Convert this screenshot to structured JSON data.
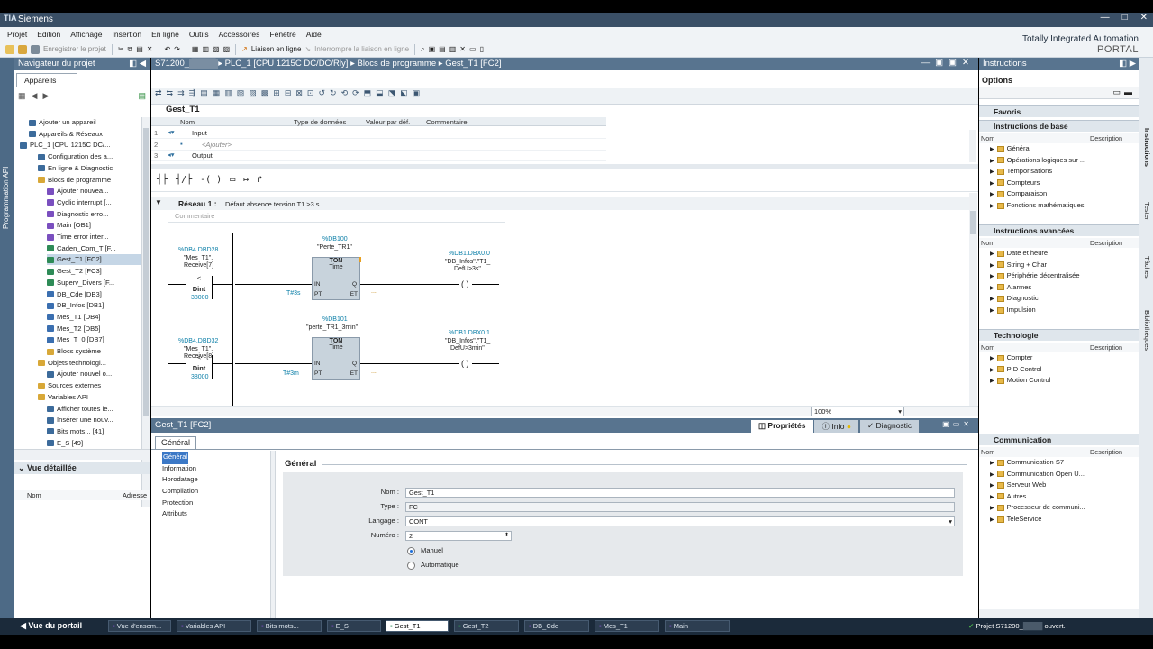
{
  "app": {
    "title": "Siemens",
    "brand_line1": "Totally Integrated Automation",
    "brand_line2": "PORTAL"
  },
  "menu": [
    "Projet",
    "Edition",
    "Affichage",
    "Insertion",
    "En ligne",
    "Outils",
    "Accessoires",
    "Fenêtre",
    "Aide"
  ],
  "toolbar": {
    "save": "Enregistrer le projet",
    "online": "Liaison en ligne",
    "offline": "Interrompre la liaison en ligne"
  },
  "left": {
    "title": "Navigateur du projet",
    "tab": "Appareils",
    "vtab": "Programmation API",
    "tree": [
      "Ajouter un appareil",
      "Appareils & Réseaux",
      "PLC_1 [CPU 1215C DC/...",
      "Configuration des a...",
      "En ligne & Diagnostic",
      "Blocs de programme",
      "Ajouter nouvea...",
      "Cyclic interrupt [...",
      "Diagnostic erro...",
      "Main [OB1]",
      "Time error inter...",
      "Caden_Com_T [F...",
      "Gest_T1 [FC2]",
      "Gest_T2 [FC3]",
      "Superv_Divers [F...",
      "DB_Cde [DB3]",
      "DB_Infos [DB1]",
      "Mes_T1 [DB4]",
      "Mes_T2 [DB5]",
      "Mes_T_0 [DB7]",
      "Blocs système",
      "Objets technologi...",
      "Ajouter nouvel o...",
      "Sources externes",
      "Variables API",
      "Afficher toutes le...",
      "Insérer une nouv...",
      "Bits mots... [41]",
      "E_S [49]"
    ],
    "detail_title": "Vue détaillée",
    "detail_cols": [
      "Nom",
      "Adresse"
    ]
  },
  "editor": {
    "breadcrumb": [
      "S71200_",
      "PLC_1 [CPU 1215C DC/DC/Rly]",
      "Blocs de programme",
      "Gest_T1 [FC2]"
    ],
    "block_name": "Gest_T1",
    "iface_cols": [
      "Nom",
      "Type de données",
      "Valeur par déf.",
      "Commentaire"
    ],
    "iface_rows": [
      {
        "n": "1",
        "name": "Input"
      },
      {
        "n": "2",
        "name": "<Ajouter>"
      },
      {
        "n": "3",
        "name": "Output"
      }
    ],
    "network_title": "Réseau 1 :",
    "network_comment_title": "Défaut absence tension T1 >3 s",
    "comment_label": "Commentaire",
    "zoom": "100%",
    "rung1": {
      "cmp_addr": "%DB4.DBD28",
      "cmp_name": "\"Mes_T1\".",
      "cmp_name2": "Receive[7]",
      "cmp_op": "<",
      "cmp_type": "Dint",
      "cmp_val": "38000",
      "timer_db": "%DB100",
      "timer_name": "\"Perte_TR1\"",
      "timer_type": "TON",
      "timer_sub": "Time",
      "pt": "T#3s",
      "coil_addr": "%DB1.DBX0.0",
      "coil_name": "\"DB_Infos\".\"T1_",
      "coil_name2": "DefU>3s\""
    },
    "rung2": {
      "cmp_addr": "%DB4.DBD32",
      "cmp_name": "\"Mes_T1\".",
      "cmp_name2": "Receive[8]",
      "cmp_op": "<",
      "cmp_type": "Dint",
      "cmp_val": "38000",
      "timer_db": "%DB101",
      "timer_name": "\"perte_TR1_3min\"",
      "timer_type": "TON",
      "timer_sub": "Time",
      "pt": "T#3m",
      "coil_addr": "%DB1.DBX0.1",
      "coil_name": "\"DB_Infos\".\"T1_",
      "coil_name2": "DefU>3min\""
    },
    "pin_in": "IN",
    "pin_pt": "PT",
    "pin_q": "Q",
    "pin_et": "ET",
    "dashes": "..."
  },
  "props": {
    "title": "Gest_T1 [FC2]",
    "tabs": [
      "Propriétés",
      "Info",
      "Diagnostic"
    ],
    "subtab": "Général",
    "nav": [
      "Général",
      "Information",
      "Horodatage",
      "Compilation",
      "Protection",
      "Attributs"
    ],
    "section": "Général",
    "fields": {
      "nom_label": "Nom :",
      "nom": "Gest_T1",
      "type_label": "Type :",
      "type": "FC",
      "langage_label": "Langage :",
      "langage": "CONT",
      "numero_label": "Numéro :",
      "numero": "2"
    },
    "radio_manual": "Manuel",
    "radio_auto": "Automatique"
  },
  "right": {
    "title": "Instructions",
    "options": "Options",
    "favoris": "Favoris",
    "base": {
      "title": "Instructions de base",
      "items": [
        "Général",
        "Opérations logiques sur ...",
        "Temporisations",
        "Compteurs",
        "Comparaison",
        "Fonctions mathématiques"
      ]
    },
    "advanced": {
      "title": "Instructions avancées",
      "items": [
        "Date et heure",
        "String + Char",
        "Périphérie décentralisée",
        "Alarmes",
        "Diagnostic",
        "Impulsion"
      ]
    },
    "techno": {
      "title": "Technologie",
      "items": [
        "Compter",
        "PID Control",
        "Motion Control"
      ]
    },
    "comm": {
      "title": "Communication",
      "items": [
        "Communication S7",
        "Communication Open U...",
        "Serveur Web",
        "Autres",
        "Processeur de communi...",
        "TeleService"
      ]
    },
    "col_nom": "Nom",
    "col_desc": "Description",
    "vtabs": [
      "Instructions",
      "Tester",
      "Tâches",
      "Bibliothèques"
    ]
  },
  "taskbar": {
    "portal": "Vue du portail",
    "tasks": [
      "Vue d'ensem...",
      "Variables API",
      "Bits mots...",
      "E_S",
      "Gest_T1",
      "Gest_T2",
      "DB_Cde",
      "Mes_T1",
      "Main"
    ],
    "status": "Projet S71200_",
    "status2": "ouvert."
  }
}
